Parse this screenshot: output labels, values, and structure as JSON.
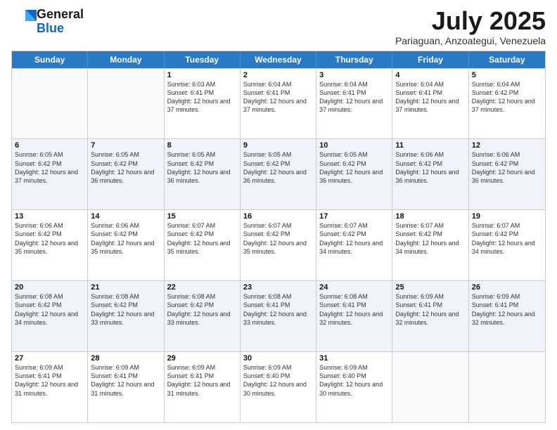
{
  "logo": {
    "general": "General",
    "blue": "Blue"
  },
  "header": {
    "month": "July 2025",
    "location": "Pariaguan, Anzoategui, Venezuela"
  },
  "weekdays": [
    "Sunday",
    "Monday",
    "Tuesday",
    "Wednesday",
    "Thursday",
    "Friday",
    "Saturday"
  ],
  "weeks": [
    [
      {
        "day": "",
        "sunrise": "",
        "sunset": "",
        "daylight": ""
      },
      {
        "day": "",
        "sunrise": "",
        "sunset": "",
        "daylight": ""
      },
      {
        "day": "1",
        "sunrise": "Sunrise: 6:03 AM",
        "sunset": "Sunset: 6:41 PM",
        "daylight": "Daylight: 12 hours and 37 minutes."
      },
      {
        "day": "2",
        "sunrise": "Sunrise: 6:04 AM",
        "sunset": "Sunset: 6:41 PM",
        "daylight": "Daylight: 12 hours and 37 minutes."
      },
      {
        "day": "3",
        "sunrise": "Sunrise: 6:04 AM",
        "sunset": "Sunset: 6:41 PM",
        "daylight": "Daylight: 12 hours and 37 minutes."
      },
      {
        "day": "4",
        "sunrise": "Sunrise: 6:04 AM",
        "sunset": "Sunset: 6:41 PM",
        "daylight": "Daylight: 12 hours and 37 minutes."
      },
      {
        "day": "5",
        "sunrise": "Sunrise: 6:04 AM",
        "sunset": "Sunset: 6:42 PM",
        "daylight": "Daylight: 12 hours and 37 minutes."
      }
    ],
    [
      {
        "day": "6",
        "sunrise": "Sunrise: 6:05 AM",
        "sunset": "Sunset: 6:42 PM",
        "daylight": "Daylight: 12 hours and 37 minutes."
      },
      {
        "day": "7",
        "sunrise": "Sunrise: 6:05 AM",
        "sunset": "Sunset: 6:42 PM",
        "daylight": "Daylight: 12 hours and 36 minutes."
      },
      {
        "day": "8",
        "sunrise": "Sunrise: 6:05 AM",
        "sunset": "Sunset: 6:42 PM",
        "daylight": "Daylight: 12 hours and 36 minutes."
      },
      {
        "day": "9",
        "sunrise": "Sunrise: 6:05 AM",
        "sunset": "Sunset: 6:42 PM",
        "daylight": "Daylight: 12 hours and 36 minutes."
      },
      {
        "day": "10",
        "sunrise": "Sunrise: 6:05 AM",
        "sunset": "Sunset: 6:42 PM",
        "daylight": "Daylight: 12 hours and 36 minutes."
      },
      {
        "day": "11",
        "sunrise": "Sunrise: 6:06 AM",
        "sunset": "Sunset: 6:42 PM",
        "daylight": "Daylight: 12 hours and 36 minutes."
      },
      {
        "day": "12",
        "sunrise": "Sunrise: 6:06 AM",
        "sunset": "Sunset: 6:42 PM",
        "daylight": "Daylight: 12 hours and 36 minutes."
      }
    ],
    [
      {
        "day": "13",
        "sunrise": "Sunrise: 6:06 AM",
        "sunset": "Sunset: 6:42 PM",
        "daylight": "Daylight: 12 hours and 35 minutes."
      },
      {
        "day": "14",
        "sunrise": "Sunrise: 6:06 AM",
        "sunset": "Sunset: 6:42 PM",
        "daylight": "Daylight: 12 hours and 35 minutes."
      },
      {
        "day": "15",
        "sunrise": "Sunrise: 6:07 AM",
        "sunset": "Sunset: 6:42 PM",
        "daylight": "Daylight: 12 hours and 35 minutes."
      },
      {
        "day": "16",
        "sunrise": "Sunrise: 6:07 AM",
        "sunset": "Sunset: 6:42 PM",
        "daylight": "Daylight: 12 hours and 35 minutes."
      },
      {
        "day": "17",
        "sunrise": "Sunrise: 6:07 AM",
        "sunset": "Sunset: 6:42 PM",
        "daylight": "Daylight: 12 hours and 34 minutes."
      },
      {
        "day": "18",
        "sunrise": "Sunrise: 6:07 AM",
        "sunset": "Sunset: 6:42 PM",
        "daylight": "Daylight: 12 hours and 34 minutes."
      },
      {
        "day": "19",
        "sunrise": "Sunrise: 6:07 AM",
        "sunset": "Sunset: 6:42 PM",
        "daylight": "Daylight: 12 hours and 34 minutes."
      }
    ],
    [
      {
        "day": "20",
        "sunrise": "Sunrise: 6:08 AM",
        "sunset": "Sunset: 6:42 PM",
        "daylight": "Daylight: 12 hours and 34 minutes."
      },
      {
        "day": "21",
        "sunrise": "Sunrise: 6:08 AM",
        "sunset": "Sunset: 6:42 PM",
        "daylight": "Daylight: 12 hours and 33 minutes."
      },
      {
        "day": "22",
        "sunrise": "Sunrise: 6:08 AM",
        "sunset": "Sunset: 6:42 PM",
        "daylight": "Daylight: 12 hours and 33 minutes."
      },
      {
        "day": "23",
        "sunrise": "Sunrise: 6:08 AM",
        "sunset": "Sunset: 6:41 PM",
        "daylight": "Daylight: 12 hours and 33 minutes."
      },
      {
        "day": "24",
        "sunrise": "Sunrise: 6:08 AM",
        "sunset": "Sunset: 6:41 PM",
        "daylight": "Daylight: 12 hours and 32 minutes."
      },
      {
        "day": "25",
        "sunrise": "Sunrise: 6:09 AM",
        "sunset": "Sunset: 6:41 PM",
        "daylight": "Daylight: 12 hours and 32 minutes."
      },
      {
        "day": "26",
        "sunrise": "Sunrise: 6:09 AM",
        "sunset": "Sunset: 6:41 PM",
        "daylight": "Daylight: 12 hours and 32 minutes."
      }
    ],
    [
      {
        "day": "27",
        "sunrise": "Sunrise: 6:09 AM",
        "sunset": "Sunset: 6:41 PM",
        "daylight": "Daylight: 12 hours and 31 minutes."
      },
      {
        "day": "28",
        "sunrise": "Sunrise: 6:09 AM",
        "sunset": "Sunset: 6:41 PM",
        "daylight": "Daylight: 12 hours and 31 minutes."
      },
      {
        "day": "29",
        "sunrise": "Sunrise: 6:09 AM",
        "sunset": "Sunset: 6:41 PM",
        "daylight": "Daylight: 12 hours and 31 minutes."
      },
      {
        "day": "30",
        "sunrise": "Sunrise: 6:09 AM",
        "sunset": "Sunset: 6:40 PM",
        "daylight": "Daylight: 12 hours and 30 minutes."
      },
      {
        "day": "31",
        "sunrise": "Sunrise: 6:09 AM",
        "sunset": "Sunset: 6:40 PM",
        "daylight": "Daylight: 12 hours and 30 minutes."
      },
      {
        "day": "",
        "sunrise": "",
        "sunset": "",
        "daylight": ""
      },
      {
        "day": "",
        "sunrise": "",
        "sunset": "",
        "daylight": ""
      }
    ]
  ]
}
